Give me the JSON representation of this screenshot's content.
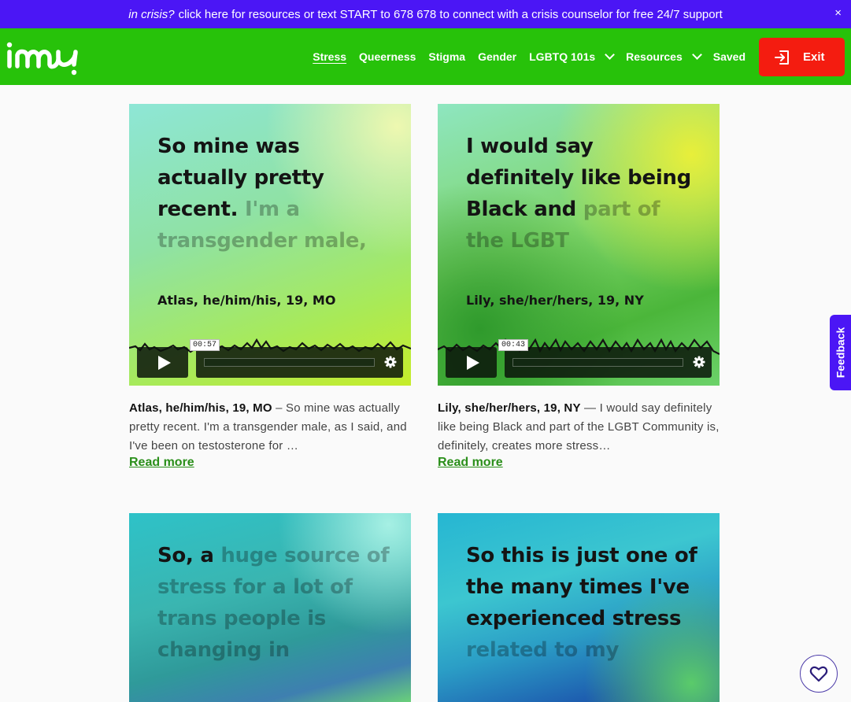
{
  "crisis_banner": {
    "lead": "in crisis?",
    "text": "click here for resources or text START to 678 678 to connect with a crisis counselor for free 24/7 support",
    "close_label": "×"
  },
  "nav": {
    "logo_alt": "imy",
    "items": [
      {
        "label": "Stress",
        "active": true
      },
      {
        "label": "Queerness"
      },
      {
        "label": "Stigma"
      },
      {
        "label": "Gender"
      },
      {
        "label": "LGBTQ 101s",
        "dropdown": true
      },
      {
        "label": "Resources",
        "dropdown": true
      },
      {
        "label": "Saved"
      }
    ],
    "exit_label": "Exit"
  },
  "cards": [
    {
      "quote_dark": "So mine was actually pretty recent.",
      "quote_dim": "I'm a transgender male,",
      "speaker": "Atlas, he/him/his, 19, MO",
      "time": "00:57",
      "desc_author": "Atlas, he/him/his, 19, MO",
      "desc_text": "So mine was actually pretty recent. I'm a transgender male, as I said, and I've been on testosterone for …",
      "read_more": "Read more"
    },
    {
      "quote_dark": "I would say definitely like being Black and",
      "quote_dim": "part of the LGBT",
      "speaker": "Lily, she/her/hers, 19, NY",
      "time": "00:43",
      "desc_author": "Lily, she/her/hers, 19, NY",
      "desc_text": "I would say definitely like being Black and part of the LGBT Community is, definitely, creates more stress…",
      "read_more": "Read more"
    },
    {
      "quote_dark": "So, a",
      "quote_dim": "huge source of stress for a lot of trans people is changing in"
    },
    {
      "quote_dark": "So this is just one of the many times I've experienced stress",
      "quote_dim": "related to my"
    }
  ],
  "feedback_label": "Feedback",
  "colors": {
    "banner": "#4b16f5",
    "nav": "#27c20a",
    "exit": "#f41c10",
    "link": "#2a8f1a"
  },
  "icons": [
    "close-icon",
    "chevron-down-icon",
    "exit-door-icon",
    "play-icon",
    "gear-icon",
    "heart-icon"
  ]
}
